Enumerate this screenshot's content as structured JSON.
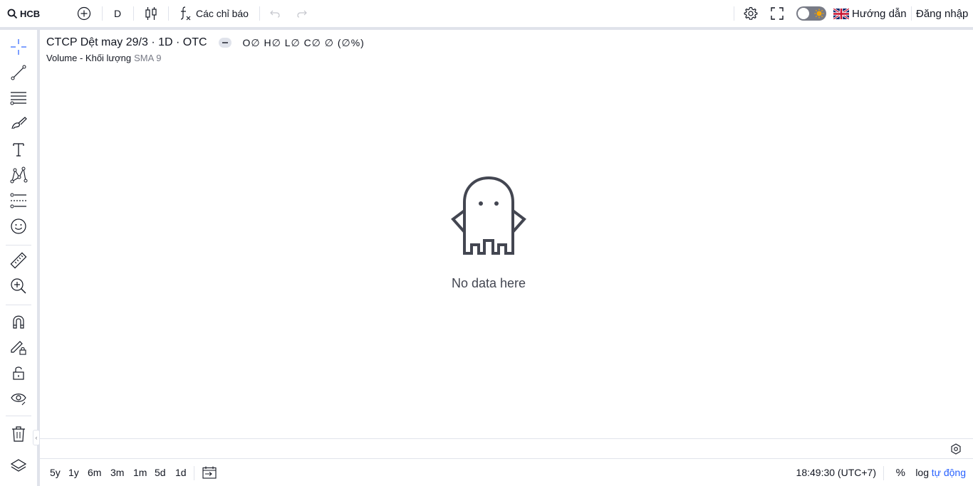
{
  "toolbar": {
    "symbol": "HCB",
    "interval": "D",
    "indicators_label": "Các chỉ báo",
    "help_label": "Hướng dẫn",
    "login_label": "Đăng nhập"
  },
  "legend": {
    "title": "CTCP Dệt may 29/3 · 1D · OTC",
    "ohlc": "O∅ H∅ L∅ C∅ ∅ (∅%)",
    "volume_label": "Volume - Khối lượng",
    "sma_label": "SMA 9"
  },
  "empty_state": {
    "message": "No data here"
  },
  "bottom": {
    "ranges": [
      "5y",
      "1y",
      "6m",
      "3m",
      "1m",
      "5d",
      "1d"
    ],
    "clock": "18:49:30 (UTC+7)",
    "percent_label": "%",
    "log_label": "log",
    "auto_label": "tự động"
  },
  "left_tools": [
    "crosshair-icon",
    "trend-line-icon",
    "fib-levels-icon",
    "brush-icon",
    "text-icon",
    "pattern-icon",
    "prediction-icon",
    "emoji-icon",
    "ruler-icon",
    "zoom-in-icon",
    "magnet-icon",
    "lock-drawing-icon",
    "unlock-icon",
    "eye-icon",
    "trash-icon",
    "layers-icon"
  ],
  "colors": {
    "accent": "#2962ff",
    "text": "#131722",
    "muted": "#787b86",
    "separator": "#e0e3eb",
    "toggle_bg": "#787b86",
    "sun": "#f7a600"
  }
}
